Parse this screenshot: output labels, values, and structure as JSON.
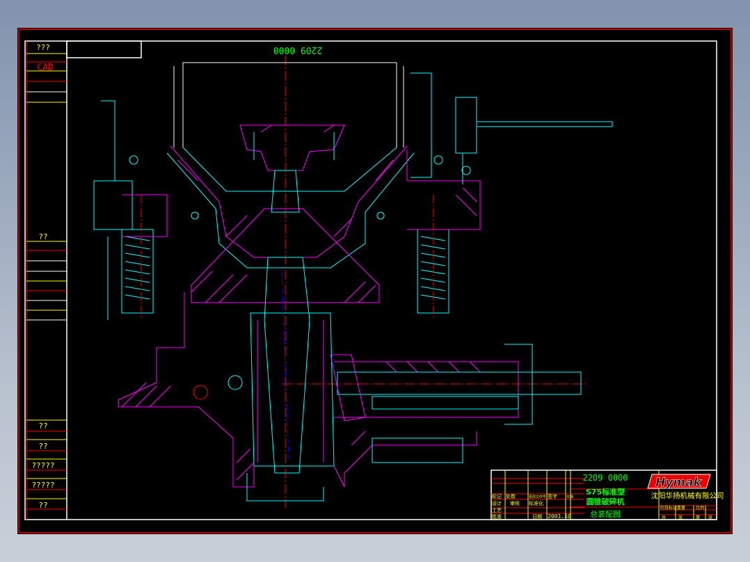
{
  "colors": {
    "frame": "#ffffff",
    "border": "#ff0000",
    "cyan": "#00ffff",
    "magenta": "#ff00ff",
    "yellow": "#ffff00",
    "green": "#00ff00",
    "red": "#ff0000"
  },
  "side_column": {
    "labels": [
      "???",
      "CAD",
      "??",
      "??",
      "??",
      "?????",
      "?????",
      "??"
    ]
  },
  "drawing_number_mirrored": "2209 0000",
  "title_block": {
    "drawing_number": "2209 0000",
    "product_model": "S75标准型",
    "product_name": "圆锥破碎机",
    "drawing_title": "总装配图",
    "company": "沈阳华扬机械有限公司",
    "logo_text": "Hymak",
    "revision_headers": [
      "标记",
      "处数",
      "更改文件号",
      "签字",
      "日期"
    ],
    "role_labels": [
      "设计",
      "审核",
      "标准化",
      "工艺",
      "批准",
      "日期"
    ],
    "date": "2001.10",
    "stage_headers": [
      "阶段标记",
      "重量",
      "比例"
    ],
    "sheet_labels": [
      "共",
      "张",
      "第",
      "张"
    ]
  }
}
